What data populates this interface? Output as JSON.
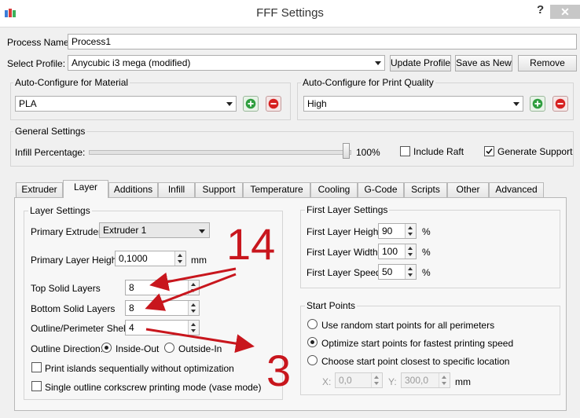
{
  "window": {
    "title": "FFF Settings",
    "help": "?",
    "close": "✕"
  },
  "process": {
    "name_label": "Process Name:",
    "name_value": "Process1"
  },
  "profile": {
    "label": "Select Profile:",
    "value": "Anycubic i3 mega (modified)",
    "update_btn": "Update Profile",
    "save_as_new_btn": "Save as New",
    "remove_btn": "Remove"
  },
  "material": {
    "group_title": "Auto-Configure for Material",
    "value": "PLA"
  },
  "quality": {
    "group_title": "Auto-Configure for Print Quality",
    "value": "High"
  },
  "general": {
    "group_title": "General Settings",
    "infill_label": "Infill Percentage:",
    "infill_value": "100%",
    "infill_fraction": 1.0,
    "include_raft": "Include Raft",
    "include_raft_checked": false,
    "generate_support": "Generate Support",
    "generate_support_checked": true
  },
  "tabs": [
    "Extruder",
    "Layer",
    "Additions",
    "Infill",
    "Support",
    "Temperature",
    "Cooling",
    "G-Code",
    "Scripts",
    "Other",
    "Advanced"
  ],
  "active_tab": "Layer",
  "layer": {
    "group_title": "Layer Settings",
    "primary_extruder_label": "Primary Extruder",
    "primary_extruder_value": "Extruder 1",
    "primary_layer_height_label": "Primary Layer Height",
    "primary_layer_height_value": "0,1000",
    "unit_mm": "mm",
    "top_solid_label": "Top Solid Layers",
    "top_solid_value": "8",
    "bottom_solid_label": "Bottom Solid Layers",
    "bottom_solid_value": "8",
    "outline_shells_label": "Outline/Perimeter Shells",
    "outline_shells_value": "4",
    "outline_direction_label": "Outline Direction:",
    "inside_out": "Inside-Out",
    "outside_in": "Outside-In",
    "outline_direction_selected": "Inside-Out",
    "print_islands": "Print islands sequentially without optimization",
    "single_outline": "Single outline corkscrew printing mode (vase mode)"
  },
  "first_layer": {
    "group_title": "First Layer Settings",
    "height_label": "First Layer Height",
    "height_value": "90",
    "width_label": "First Layer Width",
    "width_value": "100",
    "speed_label": "First Layer Speed",
    "speed_value": "50",
    "unit_pct": "%"
  },
  "start_points": {
    "group_title": "Start Points",
    "opt_random": "Use random start points for all perimeters",
    "opt_optimize": "Optimize start points for fastest printing speed",
    "opt_closest": "Choose start point closest to specific location",
    "selected": "opt_optimize",
    "x_label": "X:",
    "x_value": "0,0",
    "y_label": "Y:",
    "y_value": "300,0",
    "unit_mm": "mm"
  },
  "annotations": {
    "big_number_top": "14",
    "big_number_bottom": "3",
    "color": "#c8161d"
  }
}
